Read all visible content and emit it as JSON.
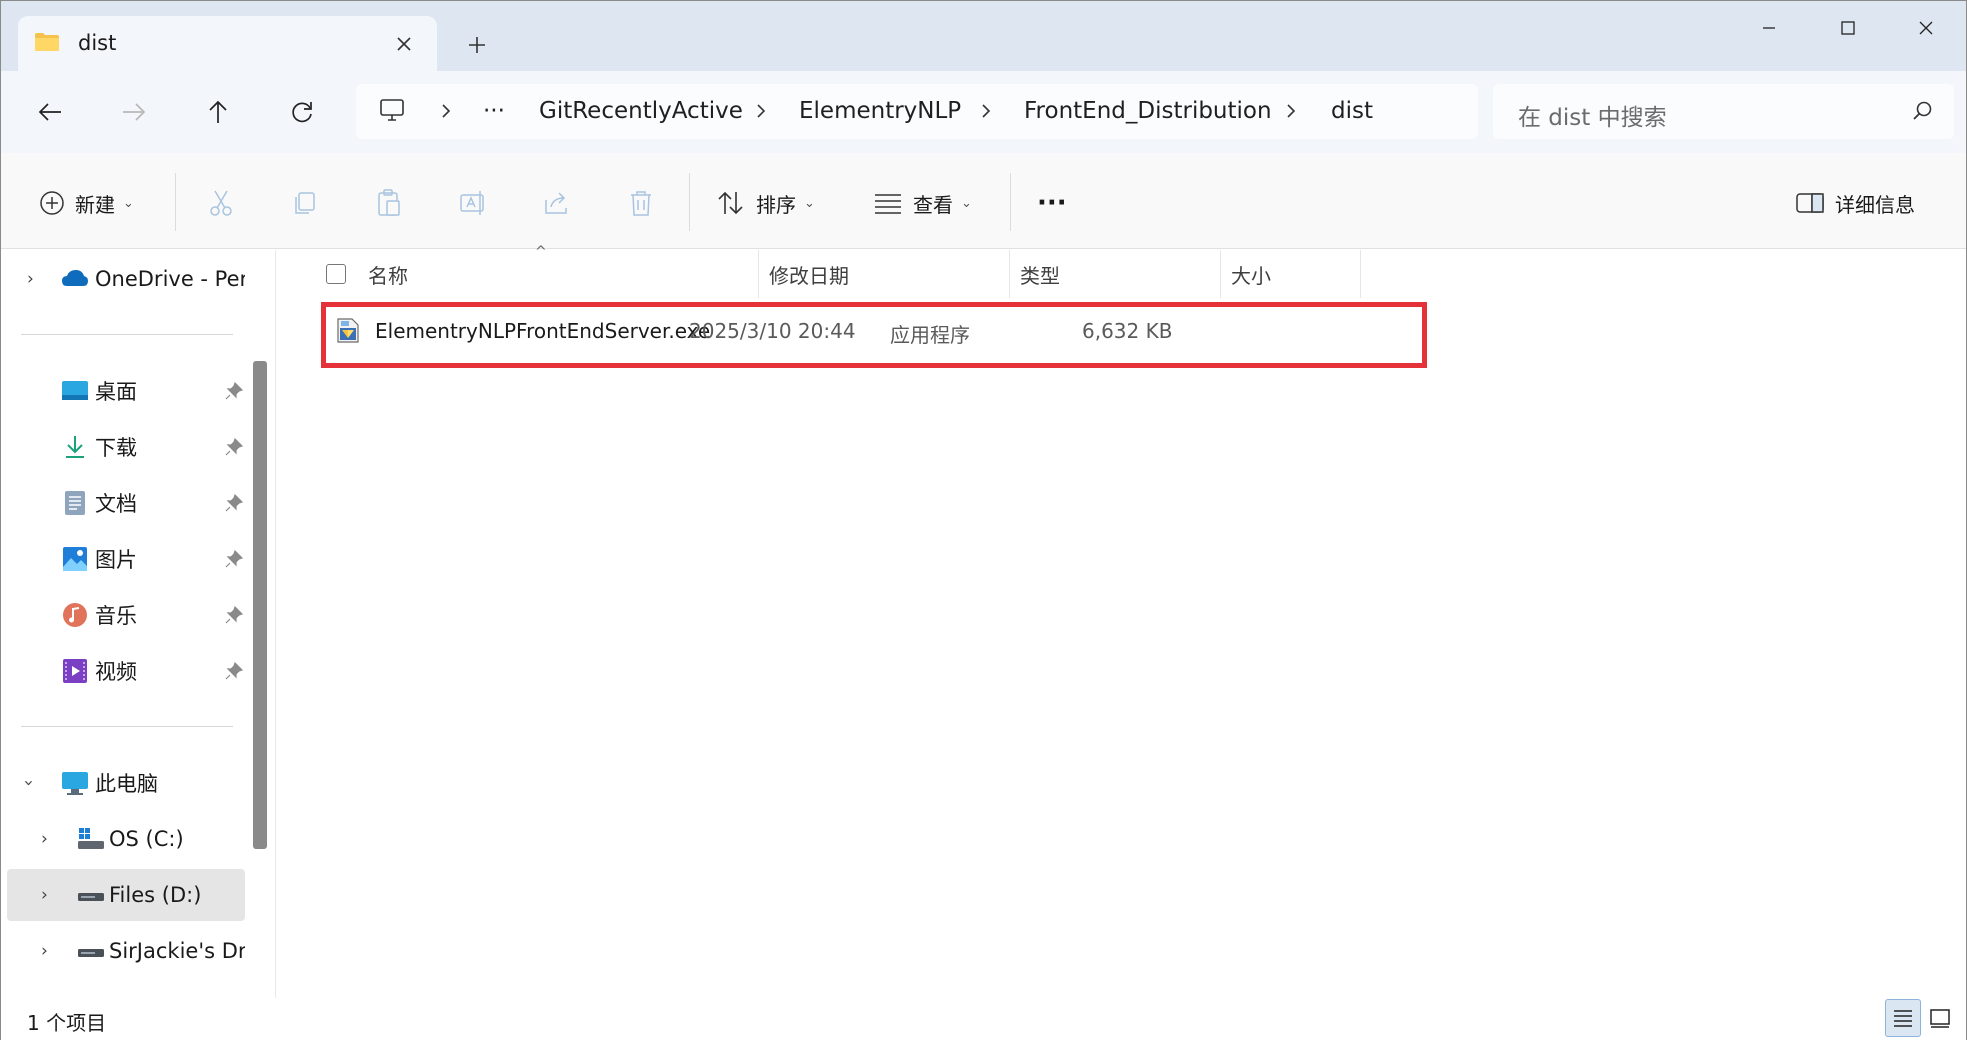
{
  "tab": {
    "title": "dist"
  },
  "address": {
    "overflow": "···",
    "crumbs": [
      "GitRecentlyActive",
      "ElementryNLP",
      "FrontEnd_Distribution",
      "dist"
    ]
  },
  "search": {
    "placeholder": "在 dist 中搜索"
  },
  "toolbar": {
    "new_label": "新建",
    "sort_label": "排序",
    "view_label": "查看",
    "more": "···",
    "details_label": "详细信息"
  },
  "nav": {
    "onedrive": "OneDrive - Per",
    "quick": [
      {
        "label": "桌面"
      },
      {
        "label": "下载"
      },
      {
        "label": "文档"
      },
      {
        "label": "图片"
      },
      {
        "label": "音乐"
      },
      {
        "label": "视频"
      }
    ],
    "this_pc": "此电脑",
    "drives": [
      {
        "label": "OS (C:)"
      },
      {
        "label": "Files (D:)"
      },
      {
        "label": "SirJackie's Dri"
      }
    ]
  },
  "columns": {
    "name": "名称",
    "date": "修改日期",
    "type": "类型",
    "size": "大小"
  },
  "files": [
    {
      "name": "ElementryNLPFrontEndServer.exe",
      "date": "2025/3/10 20:44",
      "type": "应用程序",
      "size": "6,632 KB"
    }
  ],
  "status": {
    "count": "1 个项目"
  },
  "colors": {
    "highlight": "#e53238",
    "accent": "#0067c0",
    "titlebar": "#dde6f1"
  }
}
